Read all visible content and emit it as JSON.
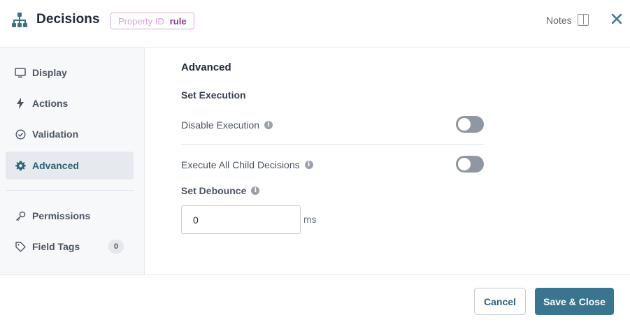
{
  "header": {
    "title": "Decisions",
    "property_label": "Property ID",
    "property_value": "rule",
    "notes_label": "Notes",
    "icon": "sitemap-icon"
  },
  "sidebar": {
    "items": [
      {
        "label": "Display",
        "icon": "monitor-icon"
      },
      {
        "label": "Actions",
        "icon": "lightning-icon"
      },
      {
        "label": "Validation",
        "icon": "check-circle-icon"
      },
      {
        "label": "Advanced",
        "icon": "gear-icon",
        "active": true
      },
      {
        "label": "Permissions",
        "icon": "key-icon"
      },
      {
        "label": "Field Tags",
        "icon": "tag-icon",
        "count": "0"
      }
    ]
  },
  "main": {
    "section_title": "Advanced",
    "sub_title": "Set Execution",
    "disable_execution_label": "Disable Execution",
    "disable_execution_on": false,
    "execute_all_label": "Execute All Child Decisions",
    "execute_all_on": false,
    "debounce_label": "Set Debounce",
    "debounce_value": "0",
    "debounce_unit": "ms"
  },
  "footer": {
    "cancel_label": "Cancel",
    "save_label": "Save & Close"
  },
  "colors": {
    "accent": "#3a7590",
    "active_bg": "#e6eaee",
    "badge_border": "#d9a6d8",
    "badge_value": "#8b3a8f"
  }
}
